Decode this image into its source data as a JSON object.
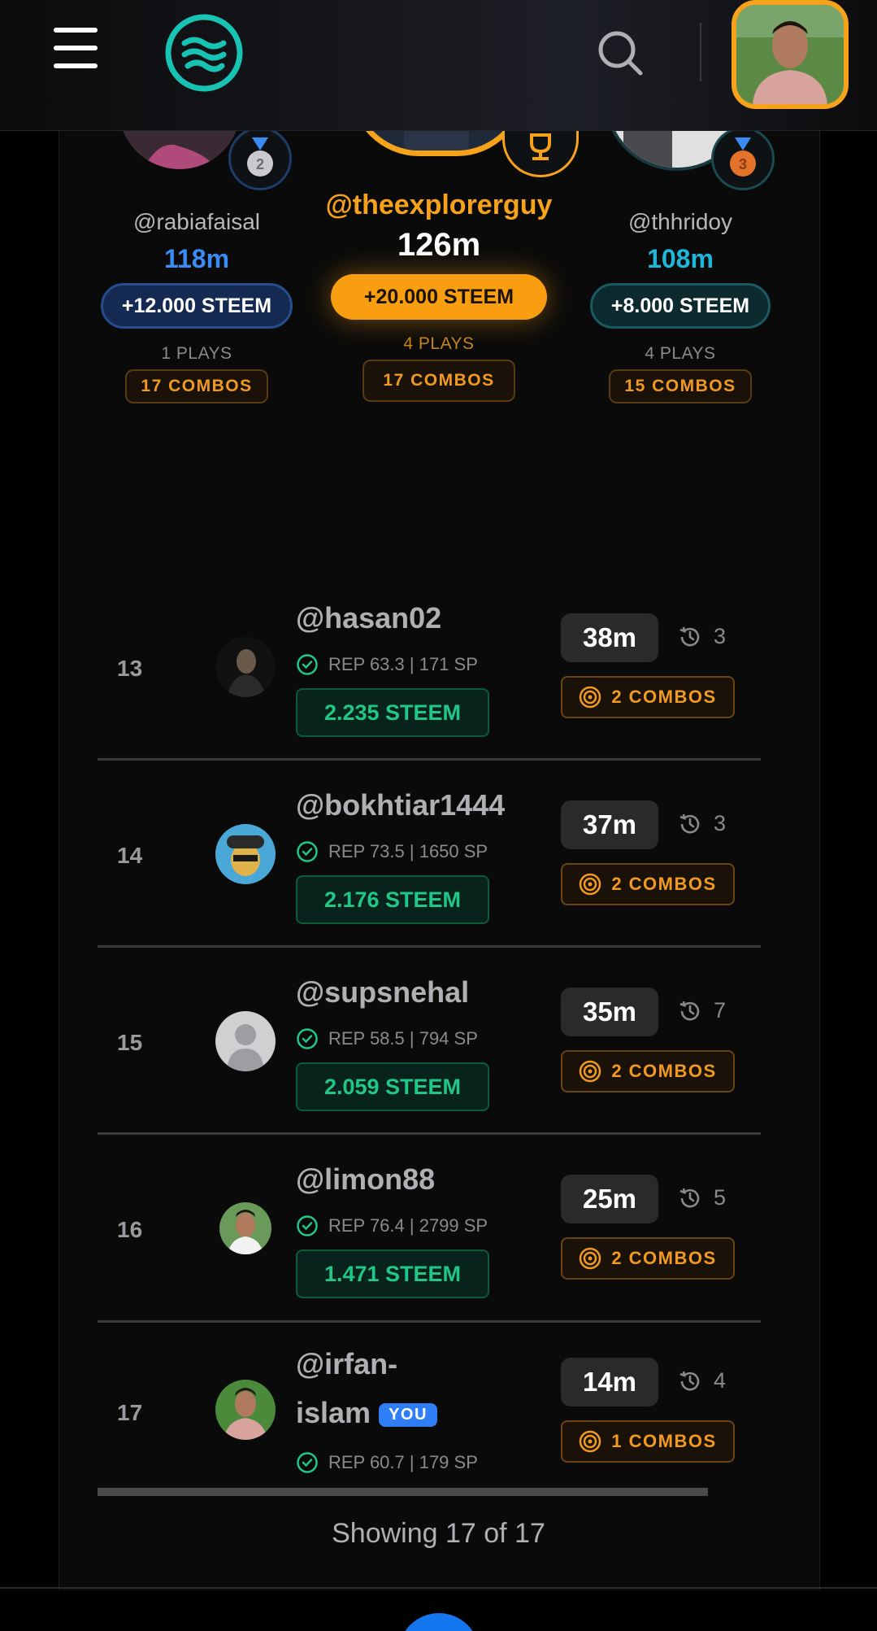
{
  "podium": [
    {
      "place": 2,
      "username": "@rabiafaisal",
      "score": "118m",
      "reward": "+12.000 STEEM",
      "plays": "1 PLAYS",
      "combos": "17 COMBOS",
      "medal": "2"
    },
    {
      "place": 1,
      "username": "@theexplorerguy",
      "score": "126m",
      "reward": "+20.000 STEEM",
      "plays": "4 PLAYS",
      "combos": "17 COMBOS"
    },
    {
      "place": 3,
      "username": "@thhridoy",
      "score": "108m",
      "reward": "+8.000 STEEM",
      "plays": "4 PLAYS",
      "combos": "15 COMBOS",
      "medal": "3"
    }
  ],
  "rows": [
    {
      "rank": "13",
      "username": "@hasan02",
      "rep": "REP 63.3 | 171 SP",
      "steem": "2.235 STEEM",
      "score": "38m",
      "plays": "3",
      "combos": "2 COMBOS"
    },
    {
      "rank": "14",
      "username": "@bokhtiar1444",
      "rep": "REP 73.5 | 1650 SP",
      "steem": "2.176 STEEM",
      "score": "37m",
      "plays": "3",
      "combos": "2 COMBOS"
    },
    {
      "rank": "15",
      "username": "@supsnehal",
      "rep": "REP 58.5 | 794 SP",
      "steem": "2.059 STEEM",
      "score": "35m",
      "plays": "7",
      "combos": "2 COMBOS"
    },
    {
      "rank": "16",
      "username": "@limon88",
      "rep": "REP 76.4 | 2799 SP",
      "steem": "1.471 STEEM",
      "score": "25m",
      "plays": "5",
      "combos": "2 COMBOS"
    },
    {
      "rank": "17",
      "username_line1": "@irfan-",
      "username_line2": "islam",
      "you_badge": "YOU",
      "rep": "REP 60.7 | 179 SP",
      "score": "14m",
      "plays": "4",
      "combos": "1 COMBOS"
    }
  ],
  "footer": {
    "showing": "Showing 17 of 17"
  },
  "colors": {
    "accent": "#f7a21b",
    "steem_green": "#20c787",
    "second_blue": "#3b8bf5",
    "third_cyan": "#1fb6d9",
    "combo_orange": "#f29a20"
  },
  "icons": [
    "menu-icon",
    "logo-waves-icon",
    "search-icon",
    "silver-medal-icon",
    "trophy-icon",
    "bronze-medal-icon",
    "verified-check-icon",
    "history-icon",
    "target-icon"
  ]
}
